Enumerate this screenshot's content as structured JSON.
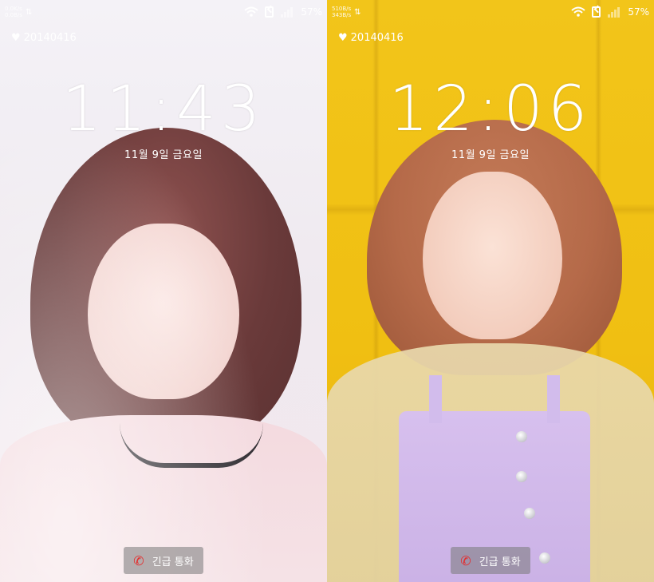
{
  "screens": [
    {
      "status": {
        "net_up": "0.0K/s",
        "net_down": "0.0B/s",
        "battery": "57%"
      },
      "anniversary": "20140416",
      "time": "11:43",
      "date": "11월 9일 금요일",
      "emergency_label": "긴급 통화"
    },
    {
      "status": {
        "net_up": "510B/s",
        "net_down": "343B/s",
        "battery": "57%"
      },
      "anniversary": "20140416",
      "time": "12:06",
      "date": "11월 9일 금요일",
      "emergency_label": "긴급 통화"
    }
  ],
  "icons": {
    "wifi": "wifi-icon",
    "sim": "sim-icon",
    "signal": "signal-icon",
    "heart": "heart-icon",
    "phone": "phone-icon"
  },
  "colors": {
    "emergency_icon": "#e62a2a",
    "overlay_text": "#ffffff"
  }
}
